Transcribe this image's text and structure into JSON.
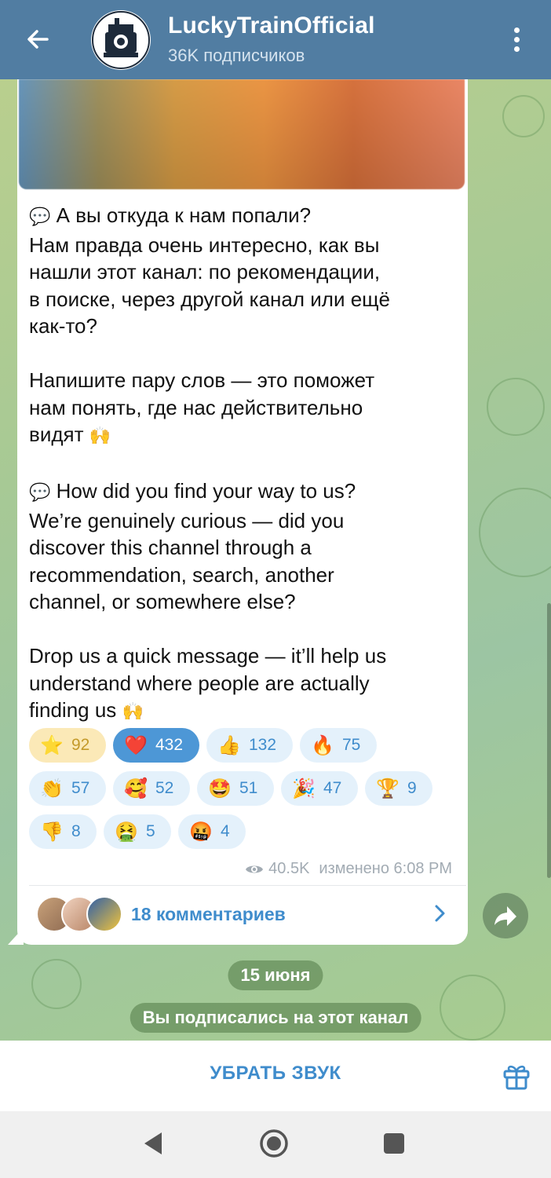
{
  "header": {
    "title": "LuckyTrainOfficial",
    "subtitle": "36K подписчиков",
    "back_icon": "arrow-left-icon",
    "menu_icon": "more-vertical-icon"
  },
  "post": {
    "paragraphs": [
      {
        "emoji": "💬",
        "lines": [
          "А вы откуда к нам попали?",
          "Нам правда очень интересно, как вы",
          "нашли этот канал: по рекомендации,",
          "в поиске, через другой канал или ещё",
          "как-то?"
        ]
      },
      {
        "lines": [
          "Напишите пару слов — это поможет",
          "нам понять, где нас действительно",
          "видят"
        ],
        "trailing_emoji": "🙌"
      },
      {
        "emoji": "💬",
        "lines": [
          "How did you find your way to us?",
          "We’re genuinely curious — did you",
          "discover this channel through a",
          "recommendation, search, another",
          "channel, or somewhere else?"
        ]
      },
      {
        "lines": [
          "Drop us a quick message — it’ll help us",
          "understand where people are actually",
          "finding us"
        ],
        "trailing_emoji": "🙌"
      }
    ],
    "reactions": [
      {
        "emoji": "⭐",
        "count": "92",
        "style": "gold"
      },
      {
        "emoji": "❤️",
        "count": "432",
        "style": "chosen"
      },
      {
        "emoji": "👍",
        "count": "132"
      },
      {
        "emoji": "🔥",
        "count": "75"
      },
      {
        "emoji": "👏",
        "count": "57"
      },
      {
        "emoji": "🥰",
        "count": "52"
      },
      {
        "emoji": "🤩",
        "count": "51"
      },
      {
        "emoji": "🎉",
        "count": "47"
      },
      {
        "emoji": "🏆",
        "count": "9"
      },
      {
        "emoji": "👎",
        "count": "8"
      },
      {
        "emoji": "🤮",
        "count": "5"
      },
      {
        "emoji": "🤬",
        "count": "4"
      }
    ],
    "views": "40.5K",
    "edited": "изменено 6:08 PM",
    "comments": "18 комментариев"
  },
  "chat": {
    "date_pill": "15 июня",
    "service_message": "Вы подписались на этот канал"
  },
  "bottom": {
    "mute_label": "УБРАТЬ ЗВУК",
    "gift_icon": "gift-icon"
  },
  "colors": {
    "header": "#517da2",
    "accent": "#3f8ccc",
    "chosen_reaction": "#4d97d6"
  }
}
